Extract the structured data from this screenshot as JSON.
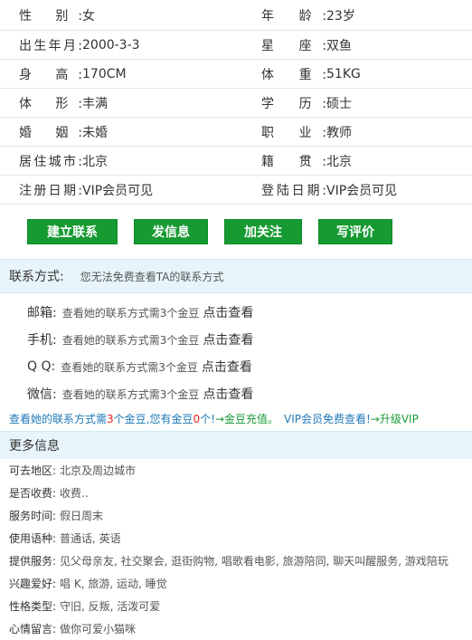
{
  "profile": [
    {
      "l_label": "性    别:",
      "l_value": "女",
      "r_label": "年    龄:",
      "r_value": "23岁"
    },
    {
      "l_label": "出生年月:",
      "l_value": "2000-3-3",
      "r_label": "星    座:",
      "r_value": "双鱼"
    },
    {
      "l_label": "身    高:",
      "l_value": "170CM",
      "r_label": "体    重:",
      "r_value": "51KG"
    },
    {
      "l_label": "体    形:",
      "l_value": "丰满",
      "r_label": "学    历:",
      "r_value": "硕士"
    },
    {
      "l_label": "婚    姻:",
      "l_value": "未婚",
      "r_label": "职    业:",
      "r_value": "教师"
    },
    {
      "l_label": "居住城市:",
      "l_value": "北京",
      "r_label": "籍    贯:",
      "r_value": "北京"
    },
    {
      "l_label": "注册日期:",
      "l_value": "VIP会员可见",
      "r_label": "登陆日期:",
      "r_value": "VIP会员可见"
    }
  ],
  "actions": {
    "contact": "建立联系",
    "message": "发信息",
    "follow": "加关注",
    "review": "写评价"
  },
  "contact_section": {
    "title": "联系方式:",
    "note": "您无法免费查看TA的联系方式",
    "items": [
      {
        "label": "邮箱:",
        "text": "查看她的联系方式需3个金豆",
        "link": "点击查看"
      },
      {
        "label": "手机:",
        "text": "查看她的联系方式需3个金豆",
        "link": "点击查看"
      },
      {
        "label": "Q  Q:",
        "text": "查看她的联系方式需3个金豆",
        "link": "点击查看"
      },
      {
        "label": "微信:",
        "text": "查看她的联系方式需3个金豆",
        "link": "点击查看"
      }
    ]
  },
  "notice": {
    "part1": "查看她的联系方式需",
    "need": "3",
    "part2": "个金豆,您有金豆",
    "have": "0",
    "part3": "个!",
    "recharge": "→金豆充值。",
    "vip_text": "VIP会员免费查看!",
    "upgrade": "→升级VIP"
  },
  "more": {
    "title": "更多信息",
    "items": [
      {
        "label": "可去地区:",
        "value": "北京及周边城市"
      },
      {
        "label": "是否收费:",
        "value": "收费.."
      },
      {
        "label": "服务时间:",
        "value": "假日周末"
      },
      {
        "label": "使用语种:",
        "value": "普通话, 英语"
      },
      {
        "label": "提供服务:",
        "value": "见父母亲友, 社交聚会, 逛街购物, 唱歌看电影, 旅游陪同, 聊天叫醒服务, 游戏陪玩"
      },
      {
        "label": "兴趣爱好:",
        "value": "唱 K, 旅游, 运动, 睡觉"
      },
      {
        "label": "性格类型:",
        "value": "守旧, 反叛, 活泼可爱"
      },
      {
        "label": "心情留言:",
        "value": "做你可爱小猫咪"
      }
    ]
  }
}
